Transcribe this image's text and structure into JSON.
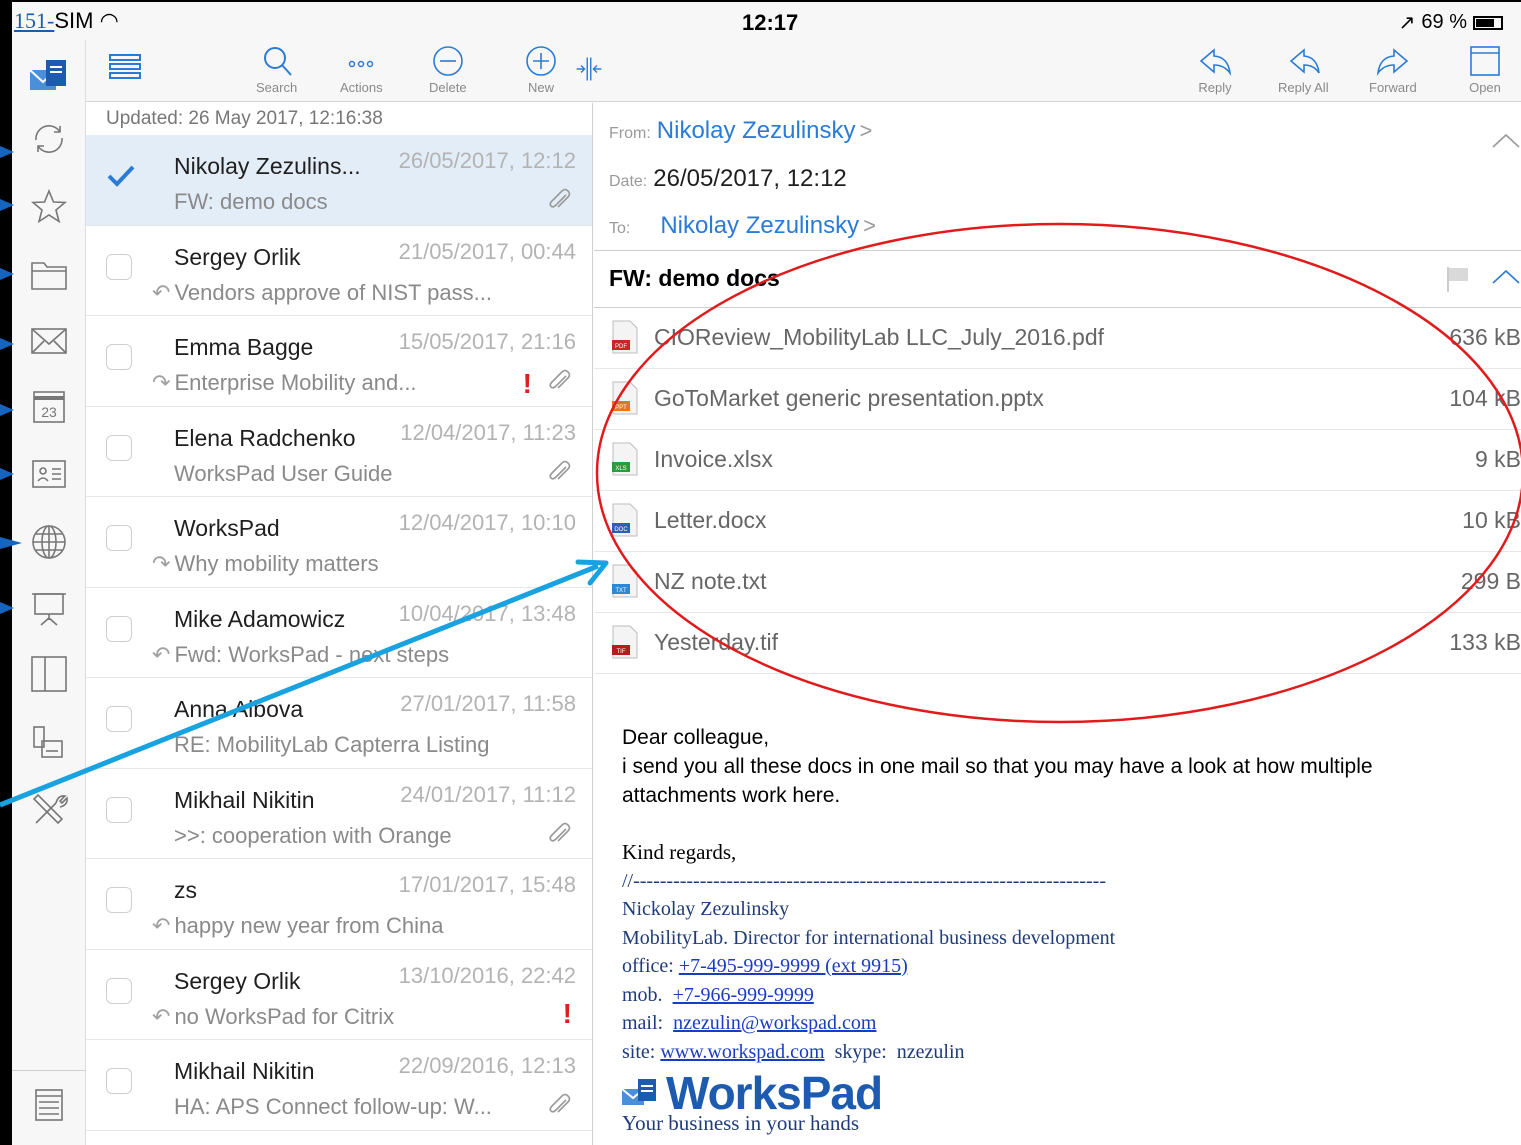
{
  "status": {
    "prefix": "151-",
    "carrier": "SIM",
    "time": "12:17",
    "battery": "69 %",
    "battery_level": 0.69
  },
  "toolbar": {
    "search": "Search",
    "actions": "Actions",
    "delete": "Delete",
    "new": "New",
    "reply": "Reply",
    "reply_all": "Reply All",
    "forward": "Forward",
    "open": "Open"
  },
  "list": {
    "updated": "Updated: 26 May 2017, 12:16:38",
    "messages": [
      {
        "sender": "Nikolay Zezulins...",
        "date": "26/05/2017, 12:12",
        "subject": "FW: demo docs",
        "attachment": true,
        "important": false,
        "status": "none",
        "selected": true
      },
      {
        "sender": "Sergey Orlik",
        "date": "21/05/2017, 00:44",
        "subject": "Vendors approve of NIST pass...",
        "attachment": false,
        "important": false,
        "status": "replied"
      },
      {
        "sender": "Emma Bagge",
        "date": "15/05/2017, 21:16",
        "subject": "Enterprise Mobility and...",
        "attachment": true,
        "important": true,
        "status": "forwarded"
      },
      {
        "sender": "Elena Radchenko",
        "date": "12/04/2017, 11:23",
        "subject": "WorksPad User Guide",
        "attachment": true,
        "important": false,
        "status": "none"
      },
      {
        "sender": "WorksPad",
        "date": "12/04/2017, 10:10",
        "subject": "Why mobility matters",
        "attachment": false,
        "important": false,
        "status": "forwarded"
      },
      {
        "sender": "Mike Adamowicz",
        "date": "10/04/2017, 13:48",
        "subject": "Fwd: WorksPad - next steps",
        "attachment": false,
        "important": false,
        "status": "replied"
      },
      {
        "sender": "Anna Albova",
        "date": "27/01/2017, 11:58",
        "subject": "RE: MobilityLab Capterra Listing",
        "attachment": false,
        "important": false,
        "status": "none"
      },
      {
        "sender": "Mikhail Nikitin",
        "date": "24/01/2017, 11:12",
        "subject": ">>: cooperation with Orange",
        "attachment": true,
        "important": false,
        "status": "none"
      },
      {
        "sender": "zs",
        "date": "17/01/2017, 15:48",
        "subject": "happy new year from China",
        "attachment": false,
        "important": false,
        "status": "replied"
      },
      {
        "sender": "Sergey Orlik",
        "date": "13/10/2016, 22:42",
        "subject": "no WorksPad for Citrix",
        "attachment": false,
        "important": true,
        "status": "replied"
      },
      {
        "sender": "Mikhail Nikitin",
        "date": "22/09/2016, 12:13",
        "subject": "HA: APS Connect follow-up: W...",
        "attachment": true,
        "important": false,
        "status": "none"
      }
    ]
  },
  "reader": {
    "from_label": "From:",
    "from": "Nikolay Zezulinsky",
    "date_label": "Date:",
    "date": "26/05/2017, 12:12",
    "to_label": "To:",
    "to": "Nikolay Zezulinsky",
    "chevron": ">",
    "subject": "FW: demo docs",
    "attachments": [
      {
        "name": "CIOReview_MobilityLab LLC_July_2016.pdf",
        "size": "636 kB",
        "badge": "PDF",
        "color": "#c62828"
      },
      {
        "name": "GoToMarket generic presentation.pptx",
        "size": "104 kB",
        "badge": "PPT",
        "color": "#e8741c"
      },
      {
        "name": "Invoice.xlsx",
        "size": "9 kB",
        "badge": "XLS",
        "color": "#2e9a3c"
      },
      {
        "name": "Letter.docx",
        "size": "10 kB",
        "badge": "DOC",
        "color": "#2a5fb8"
      },
      {
        "name": "NZ note.txt",
        "size": "299 B",
        "badge": "TXT",
        "color": "#2a8ad8"
      },
      {
        "name": "Yesterday.tif",
        "size": "133 kB",
        "badge": "TIF",
        "color": "#b71c1c"
      }
    ],
    "body": {
      "greeting": "Dear colleague,",
      "line1": "i send you all these docs in one mail so that you may have a look at how multiple",
      "line2": "attachments work here."
    },
    "signature": {
      "closing": "Kind regards,",
      "separator": "//-----------------------------------------------------------------------",
      "name": "Nickolay Zezulinsky",
      "title": "MobilityLab. Director for international business development",
      "office_label": "office:",
      "office": "+7-495-999-9999 (ext 9915)",
      "mob_label": "mob.",
      "mob": "+7-966-999-9999",
      "mail_label": "mail:",
      "mail": "nzezulin@workspad.com",
      "site_label": "site:",
      "site": "www.workspad.com",
      "skype_label": "skype:",
      "skype": "nzezulin",
      "logo": "WorksPad",
      "tagline": "Your business in your hands"
    }
  },
  "colors": {
    "accent": "#2b7bd6",
    "selected_row": "#e3edf7",
    "annotation_red": "#e11b1b",
    "annotation_blue": "#19a2e0",
    "rail_arrow": "#1565c0"
  }
}
